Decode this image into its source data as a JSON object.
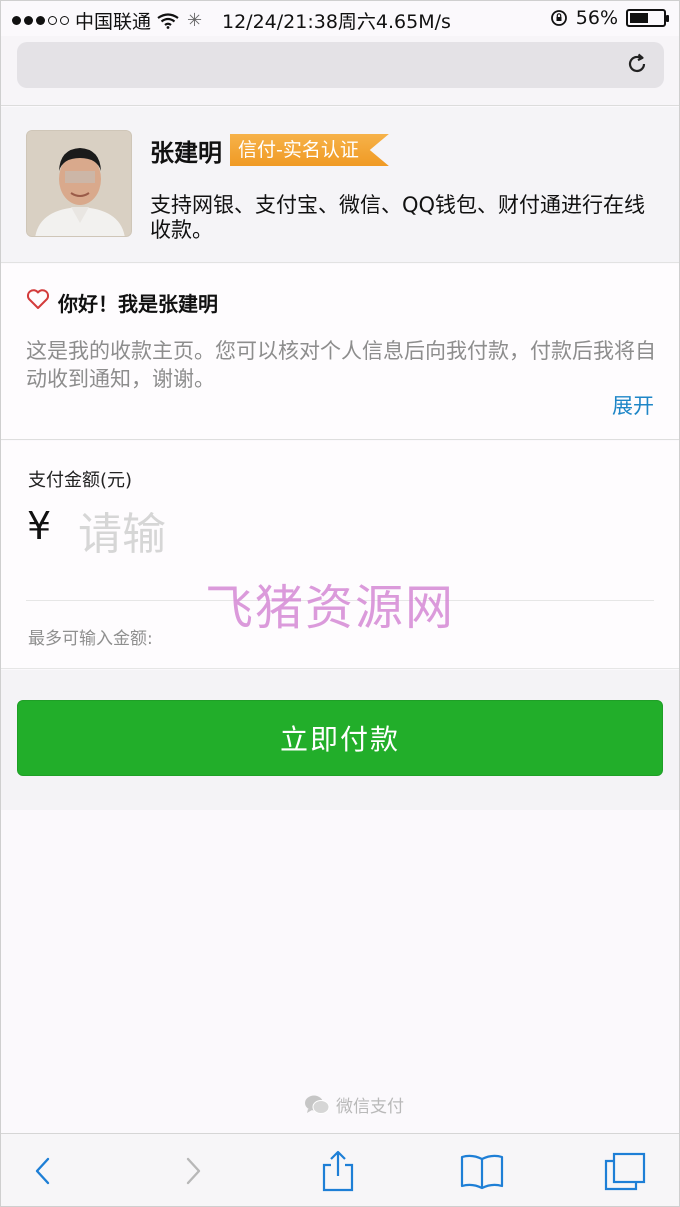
{
  "status_bar": {
    "carrier": "中国联通",
    "datetime": "12/24/21:38周六4.65M/s",
    "battery": "56%",
    "battery_level": 0.56
  },
  "profile": {
    "name": "张建明",
    "badge": "信付-实名认证",
    "support_text": "支持网银、支付宝、微信、QQ钱包、财付通进行在线收款。"
  },
  "greeting": {
    "title": "你好！我是张建明",
    "description": "这是我的收款主页。您可以核对个人信息后向我付款，付款后我将自动收到通知，谢谢。",
    "expand_label": "展开"
  },
  "payment": {
    "amount_label": "支付金额(元)",
    "currency_symbol": "¥",
    "amount_placeholder": "请输",
    "max_note": "最多可输入金额:",
    "pay_button": "立即付款"
  },
  "watermark": "飞猪资源网",
  "footer": {
    "brand": "微信支付"
  },
  "colors": {
    "accent_green": "#22ae2a",
    "link_blue": "#1e86c7",
    "badge_orange": "#f09a24",
    "watermark_pink": "#d58ad6"
  },
  "icons": {
    "reload": "reload-icon",
    "heart": "heart-icon",
    "back": "back-arrow-icon",
    "forward": "forward-arrow-icon",
    "share": "share-icon",
    "bookmarks": "bookmarks-icon",
    "tabs": "tabs-icon"
  }
}
